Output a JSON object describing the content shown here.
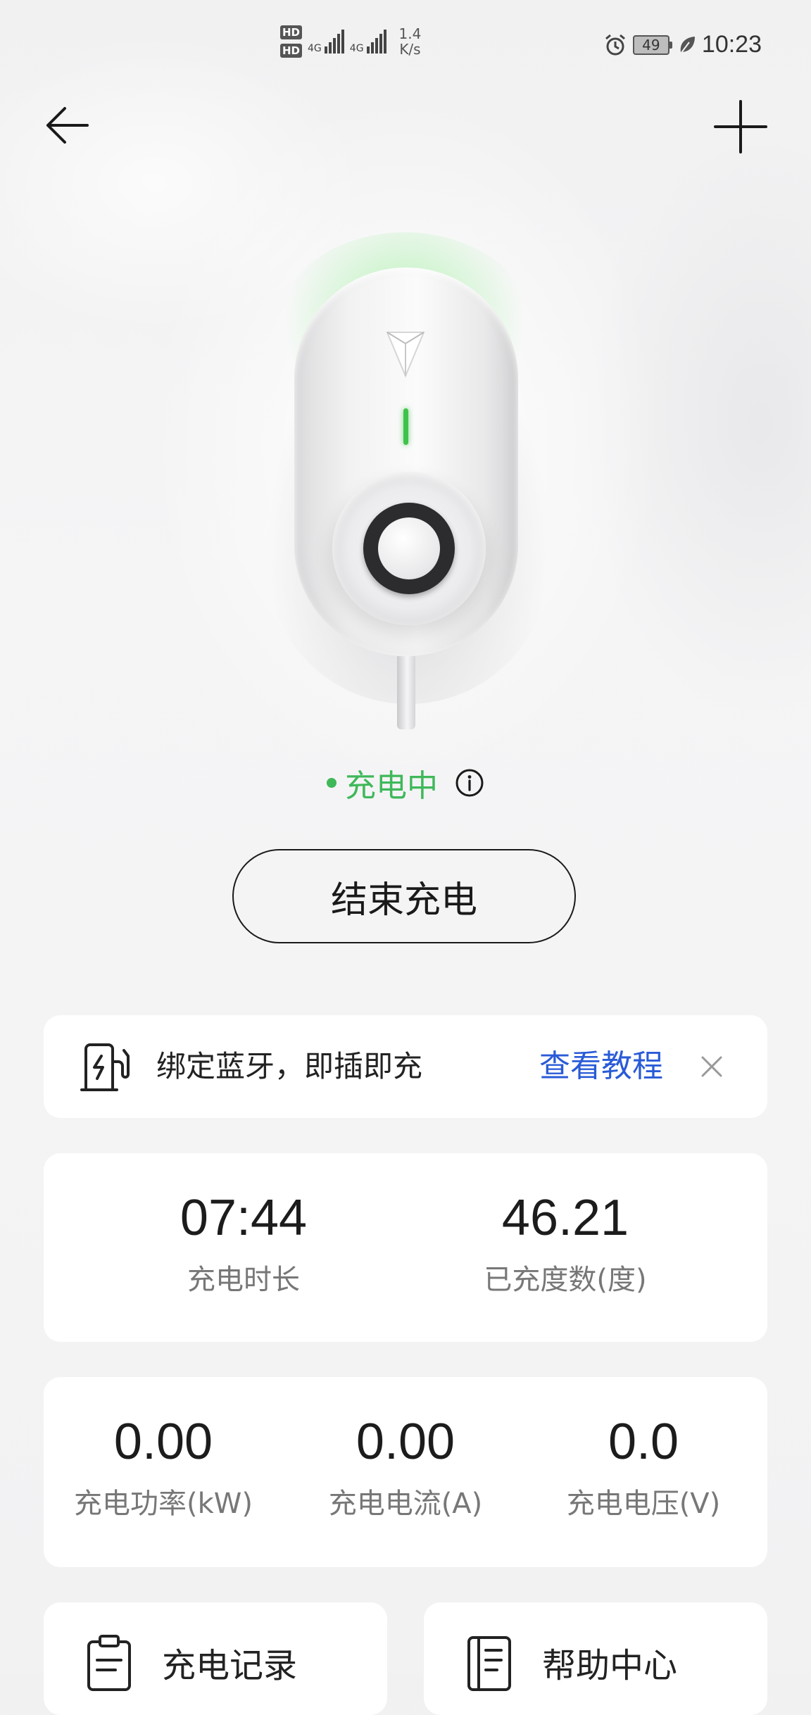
{
  "status_bar": {
    "hd1": "HD",
    "hd2": "HD",
    "sim1_net": "4G",
    "sim2_net": "4G",
    "speed_value": "1.4",
    "speed_unit": "K/s",
    "battery": "49",
    "time": "10:23"
  },
  "charger": {
    "status": "充电中",
    "status_color": "#3fb85a",
    "end_button": "结束充电"
  },
  "bluetooth_banner": {
    "text": "绑定蓝牙，即插即充",
    "link": "查看教程",
    "link_color": "#2a5bd7"
  },
  "summary": {
    "duration_value": "07:44",
    "duration_label": "充电时长",
    "energy_value": "46.21",
    "energy_label": "已充度数(度)"
  },
  "metrics": {
    "power_value": "0.00",
    "power_label": "充电功率(kW)",
    "current_value": "0.00",
    "current_label": "充电电流(A)",
    "voltage_value": "0.0",
    "voltage_label": "充电电压(V)"
  },
  "shortcuts": {
    "records": "充电记录",
    "help": "帮助中心"
  }
}
